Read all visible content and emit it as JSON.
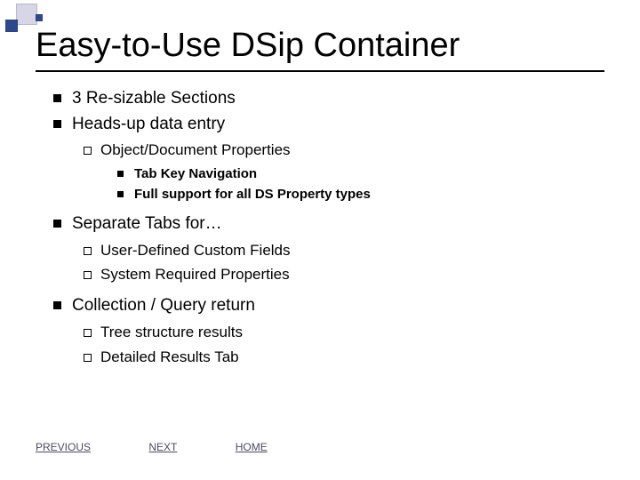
{
  "title": "Easy-to-Use DSip Container",
  "bullets": {
    "l1_0": "3 Re-sizable Sections",
    "l1_1": "Heads-up data entry",
    "l2_0": "Object/Document Properties",
    "l3_0": "Tab Key Navigation",
    "l3_1": "Full support for all DS Property types",
    "l1_2": "Separate Tabs for…",
    "l2_1": "User-Defined Custom Fields",
    "l2_2": "System Required Properties",
    "l1_3": "Collection / Query return",
    "l2_3": "Tree structure results",
    "l2_4": "Detailed Results Tab"
  },
  "footer": {
    "previous": "PREVIOUS",
    "next": "NEXT",
    "home": "HOME"
  }
}
